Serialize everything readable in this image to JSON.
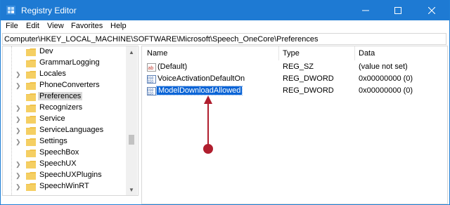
{
  "window": {
    "title": "Registry Editor",
    "controls": {
      "minimize": "minimize",
      "maximize": "maximize",
      "close": "close"
    }
  },
  "menu": [
    "File",
    "Edit",
    "View",
    "Favorites",
    "Help"
  ],
  "address": "Computer\\HKEY_LOCAL_MACHINE\\SOFTWARE\\Microsoft\\Speech_OneCore\\Preferences",
  "tree": {
    "items": [
      {
        "label": "Dev",
        "expandable": false,
        "selected": false
      },
      {
        "label": "GrammarLogging",
        "expandable": false,
        "selected": false
      },
      {
        "label": "Locales",
        "expandable": true,
        "selected": false
      },
      {
        "label": "PhoneConverters",
        "expandable": true,
        "selected": false
      },
      {
        "label": "Preferences",
        "expandable": false,
        "selected": true
      },
      {
        "label": "Recognizers",
        "expandable": true,
        "selected": false
      },
      {
        "label": "Service",
        "expandable": true,
        "selected": false
      },
      {
        "label": "ServiceLanguages",
        "expandable": true,
        "selected": false
      },
      {
        "label": "Settings",
        "expandable": true,
        "selected": false
      },
      {
        "label": "SpeechBox",
        "expandable": false,
        "selected": false
      },
      {
        "label": "SpeechUX",
        "expandable": true,
        "selected": false
      },
      {
        "label": "SpeechUXPlugins",
        "expandable": true,
        "selected": false
      },
      {
        "label": "SpeechWinRT",
        "expandable": true,
        "selected": false
      }
    ]
  },
  "list": {
    "columns": {
      "name": "Name",
      "type": "Type",
      "data": "Data"
    },
    "rows": [
      {
        "icon": "string-value-icon",
        "name": "(Default)",
        "type": "REG_SZ",
        "data": "(value not set)",
        "selected": false
      },
      {
        "icon": "dword-value-icon",
        "name": "VoiceActivationDefaultOn",
        "type": "REG_DWORD",
        "data": "0x00000000 (0)",
        "selected": false
      },
      {
        "icon": "dword-value-icon",
        "name": "ModelDownloadAllowed",
        "type": "REG_DWORD",
        "data": "0x00000000 (0)",
        "selected": true
      }
    ]
  },
  "colors": {
    "titlebar": "#1e7ad3",
    "selection": "#0a64d6",
    "folder": "#f0c24b",
    "annotation": "#b01e2e"
  }
}
